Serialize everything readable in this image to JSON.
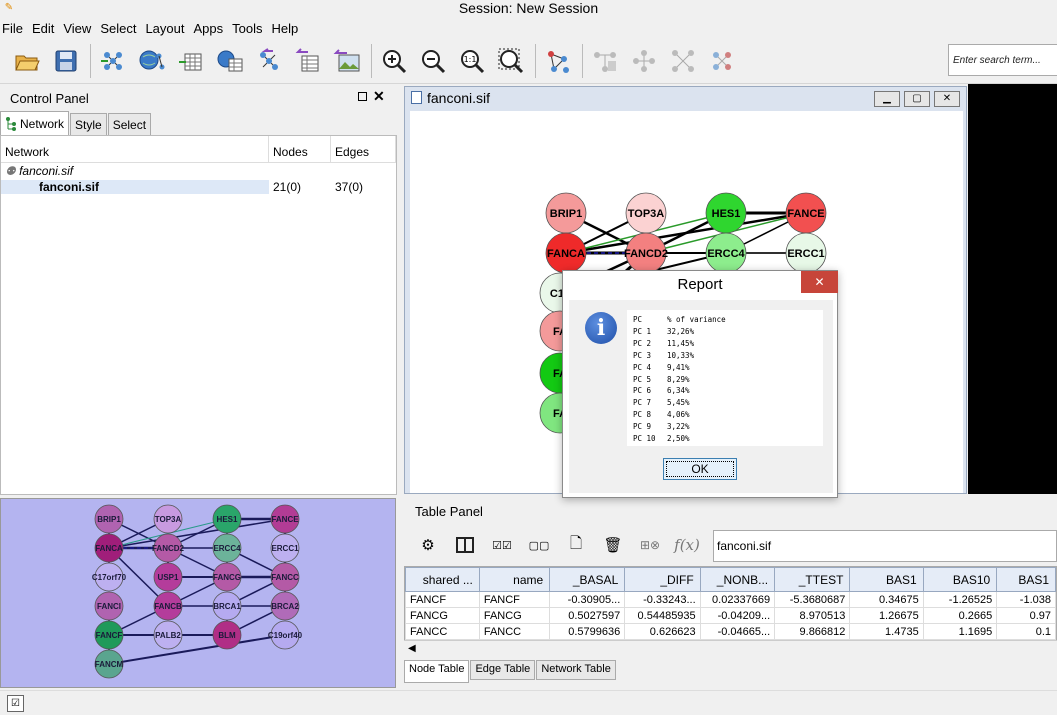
{
  "window": {
    "title": "Session: New Session"
  },
  "menu": [
    "File",
    "Edit",
    "View",
    "Select",
    "Layout",
    "Apps",
    "Tools",
    "Help"
  ],
  "toolbar": {
    "icons": [
      "open-session-icon",
      "save-session-icon",
      "import-network-file-icon",
      "import-network-url-icon",
      "import-table-file-icon",
      "import-table-url-icon",
      "export-network-icon",
      "export-table-icon",
      "export-image-icon",
      "zoom-in-icon",
      "zoom-out-icon",
      "zoom-fit-icon",
      "zoom-selected-icon",
      "apply-layout-icon",
      "first-neighbors-icon",
      "hide-selected-icon",
      "show-all-icon",
      "new-network-selected-icon"
    ],
    "search_placeholder": "Enter search term..."
  },
  "control_panel": {
    "title": "Control Panel",
    "tabs": [
      "Network",
      "Style",
      "Select"
    ],
    "columns": [
      "Network",
      "Nodes",
      "Edges"
    ],
    "collection": "fanconi.sif",
    "network": {
      "name": "fanconi.sif",
      "nodes": "21(0)",
      "edges": "37(0)"
    }
  },
  "network_view": {
    "title": "fanconi.sif",
    "nodes": [
      {
        "label": "BRIP1",
        "color": "#f49a9a"
      },
      {
        "label": "TOP3A",
        "color": "#fbd2d2"
      },
      {
        "label": "HES1",
        "color": "#2fd62f"
      },
      {
        "label": "FANCE",
        "color": "#f25050"
      },
      {
        "label": "FANCA",
        "color": "#ef2a2a"
      },
      {
        "label": "FANCD2",
        "color": "#f38080"
      },
      {
        "label": "ERCC4",
        "color": "#8ded8d"
      },
      {
        "label": "ERCC1",
        "color": "#e7f8e7"
      },
      {
        "label": "C17",
        "color": "#eaf8ea"
      },
      {
        "label": "FA",
        "color": "#f49a9a"
      },
      {
        "label": "FA",
        "color": "#13c913"
      },
      {
        "label": "FA",
        "color": "#80e680"
      }
    ]
  },
  "report": {
    "title": "Report",
    "header": [
      "PC",
      "% of variance"
    ],
    "rows": [
      [
        "PC 1",
        "32,26%"
      ],
      [
        "PC 2",
        "11,45%"
      ],
      [
        "PC 3",
        "10,33%"
      ],
      [
        "PC 4",
        "9,41%"
      ],
      [
        "PC 5",
        "8,29%"
      ],
      [
        "PC 6",
        "6,34%"
      ],
      [
        "PC 7",
        "5,45%"
      ],
      [
        "PC 8",
        "4,06%"
      ],
      [
        "PC 9",
        "3,22%"
      ],
      [
        "PC 10",
        "2,50%"
      ]
    ],
    "ok_label": "OK"
  },
  "birdseye": {
    "nodes": [
      {
        "label": "BRIP1",
        "color": "#b063b0"
      },
      {
        "label": "TOP3A",
        "color": "#c89ae0"
      },
      {
        "label": "HES1",
        "color": "#2aa56a"
      },
      {
        "label": "FANCE",
        "color": "#b23c95"
      },
      {
        "label": "FANCA",
        "color": "#a01e7a"
      },
      {
        "label": "FANCD2",
        "color": "#b45aa6"
      },
      {
        "label": "ERCC4",
        "color": "#6cb39a"
      },
      {
        "label": "ERCC1",
        "color": "#bdb0f0"
      },
      {
        "label": "C17orf70",
        "color": "#bdb0f0"
      },
      {
        "label": "USP1",
        "color": "#b43c9b"
      },
      {
        "label": "FANCG",
        "color": "#b45aa6"
      },
      {
        "label": "FANCC",
        "color": "#b45aa6"
      },
      {
        "label": "FANCI",
        "color": "#b063b0"
      },
      {
        "label": "FANCB",
        "color": "#b43c9b"
      },
      {
        "label": "BRCA1",
        "color": "#b5aaf0"
      },
      {
        "label": "BRCA2",
        "color": "#b06bb8"
      },
      {
        "label": "FANCF",
        "color": "#1f9a5a"
      },
      {
        "label": "PALB2",
        "color": "#bdb0f0"
      },
      {
        "label": "BLM",
        "color": "#b02e86"
      },
      {
        "label": "C19orf40",
        "color": "#b5aaf0"
      },
      {
        "label": "FANCM",
        "color": "#5aa58f"
      }
    ]
  },
  "table_panel": {
    "title": "Table Panel",
    "network_selector": "fanconi.sif",
    "fx_label": "f(x)",
    "columns": [
      "shared ...",
      "name",
      "_BASAL",
      "_DIFF",
      "_NONB...",
      "_TTEST",
      "BAS1",
      "BAS10",
      "BAS1"
    ],
    "rows": [
      [
        "FANCF",
        "FANCF",
        "-0.30905...",
        "-0.33243...",
        "0.02337669",
        "-5.3680687",
        "0.34675",
        "-1.26525",
        "-1.038"
      ],
      [
        "FANCG",
        "FANCG",
        "0.5027597",
        "0.54485935",
        "-0.04209...",
        "8.970513",
        "1.26675",
        "0.2665",
        "0.97"
      ],
      [
        "FANCC",
        "FANCC",
        "0.5799636",
        "0.626623",
        "-0.04665...",
        "9.866812",
        "1.4735",
        "1.1695",
        "0.1"
      ]
    ],
    "tabs": [
      "Node Table",
      "Edge Table",
      "Network Table"
    ]
  }
}
